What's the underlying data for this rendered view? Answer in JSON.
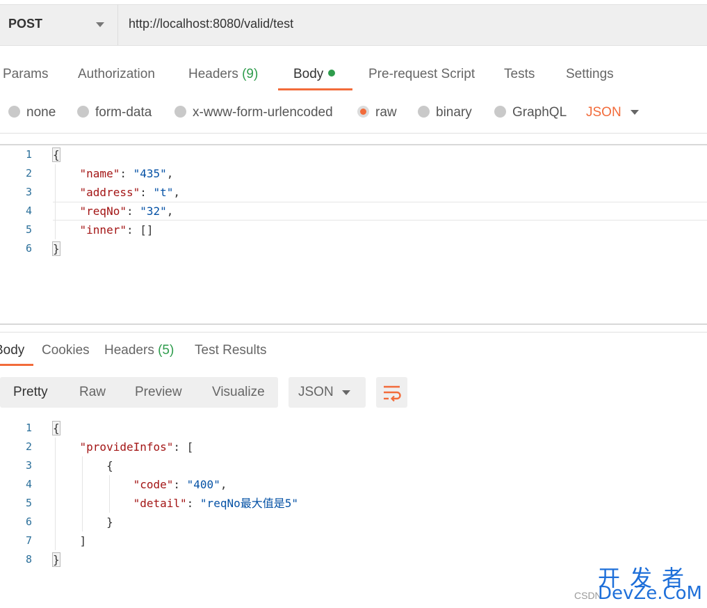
{
  "request": {
    "method": "POST",
    "url": "http://localhost:8080/valid/test",
    "tabs": [
      {
        "label": "Params"
      },
      {
        "label": "Authorization"
      },
      {
        "label": "Headers",
        "count": "(9)"
      },
      {
        "label": "Body"
      },
      {
        "label": "Pre-request Script"
      },
      {
        "label": "Tests"
      },
      {
        "label": "Settings"
      }
    ],
    "body_types": [
      "none",
      "form-data",
      "x-www-form-urlencoded",
      "raw",
      "binary",
      "GraphQL"
    ],
    "selected_body_type": "raw",
    "format": "JSON",
    "line_numbers": [
      "1",
      "2",
      "3",
      "4",
      "5",
      "6"
    ],
    "body_lines": [
      {
        "open": "{"
      },
      {
        "key": "\"name\"",
        "colon": ": ",
        "value": "\"435\"",
        "tail": ","
      },
      {
        "key": "\"address\"",
        "colon": ": ",
        "value": "\"t\"",
        "tail": ","
      },
      {
        "key": "\"reqNo\"",
        "colon": ": ",
        "value": "\"32\"",
        "tail": ","
      },
      {
        "key": "\"inner\"",
        "colon": ": ",
        "value": "[]",
        "tail": ""
      },
      {
        "open": "}"
      }
    ]
  },
  "response": {
    "tabs": [
      {
        "label": "Body"
      },
      {
        "label": "Cookies"
      },
      {
        "label": "Headers",
        "count": "(5)"
      },
      {
        "label": "Test Results"
      }
    ],
    "views": [
      "Pretty",
      "Raw",
      "Preview",
      "Visualize"
    ],
    "format": "JSON",
    "line_numbers": [
      "1",
      "2",
      "3",
      "4",
      "5",
      "6",
      "7",
      "8"
    ],
    "body_lines": [
      {
        "text": "{"
      },
      {
        "key": "\"provideInfos\"",
        "colon": ": ",
        "tail": "["
      },
      {
        "text": "{"
      },
      {
        "key": "\"code\"",
        "colon": ": ",
        "value": "\"400\"",
        "tail": ","
      },
      {
        "key": "\"detail\"",
        "colon": ": ",
        "value": "\"reqNo最大值是5\"",
        "tail": ""
      },
      {
        "text": "}"
      },
      {
        "text": "]"
      },
      {
        "text": "}"
      }
    ]
  },
  "watermark": {
    "cn": "开发者",
    "en": "DevZe.CoM",
    "csdn": "CSDN"
  },
  "colors": {
    "accent": "#f26b3a",
    "count_green": "#2e9c4c",
    "key_red": "#a31515",
    "string_blue": "#0451a5"
  }
}
